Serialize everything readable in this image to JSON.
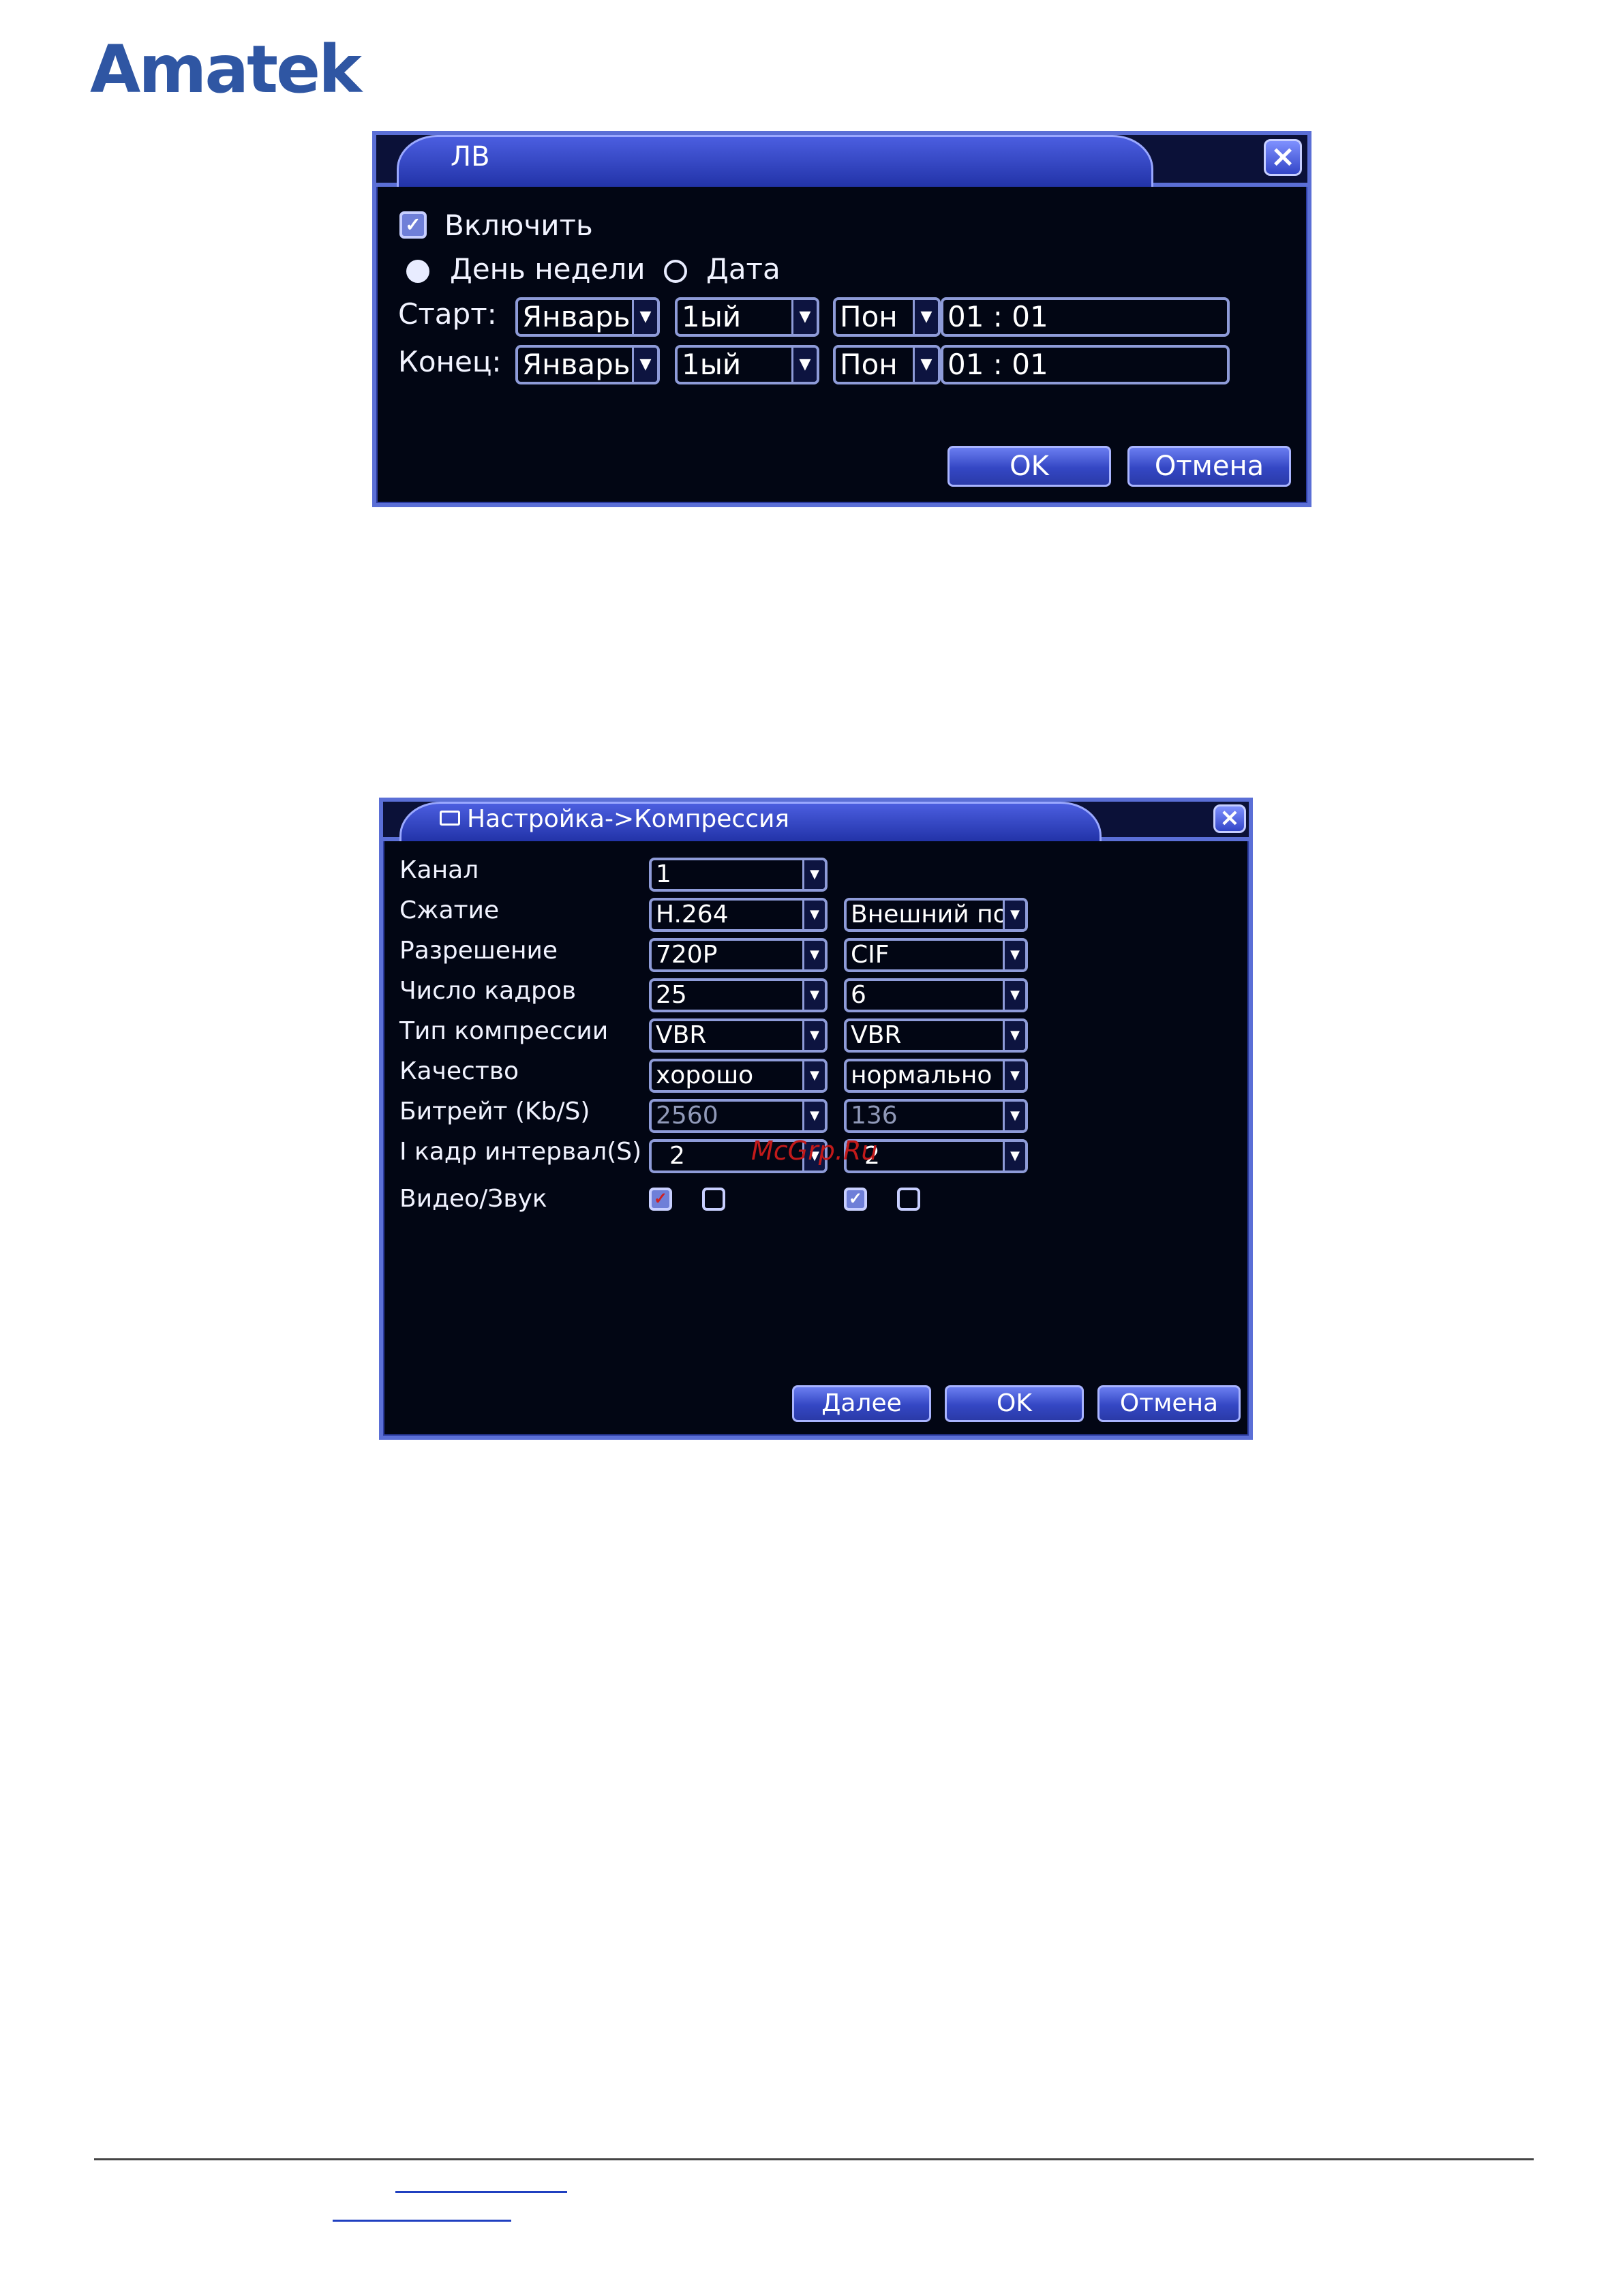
{
  "brand": "Amatek",
  "dialog1": {
    "title": "ЛВ",
    "close_glyph": "×",
    "enable_label": "Включить",
    "enable_checked": true,
    "radio_weekday_label": "День недели",
    "radio_date_label": "Дата",
    "radio_selected": "weekday",
    "start_label": "Старт:",
    "end_label": "Конец:",
    "start": {
      "month": "Январь",
      "week": "1ый",
      "day": "Пон",
      "time": "01 : 01"
    },
    "end": {
      "month": "Январь",
      "week": "1ый",
      "day": "Пон",
      "time": "01 : 01"
    },
    "ok_label": "OK",
    "cancel_label": "Отмена"
  },
  "dialog2": {
    "title": "Настройка->Компрессия",
    "close_glyph": "×",
    "rows": [
      {
        "label": "Канал",
        "main": "1"
      },
      {
        "label": "Сжатие",
        "main": "H.264",
        "extra": "Внешний по"
      },
      {
        "label": "Разрешение",
        "main": "720P",
        "extra": "CIF"
      },
      {
        "label": "Число кадров",
        "main": "25",
        "extra": "6"
      },
      {
        "label": "Тип компрессии",
        "main": "VBR",
        "extra": "VBR"
      },
      {
        "label": "Качество",
        "main": "хорошо",
        "extra": "нормально"
      },
      {
        "label": "Битрейт (Kb/S)",
        "main": "2560",
        "extra": "136"
      },
      {
        "label": "I кадр интервал(S)",
        "main": "2",
        "extra": "2"
      }
    ],
    "av_label": "Видео/Звук",
    "av_main": {
      "video": true,
      "audio": false
    },
    "av_extra": {
      "video": true,
      "audio": false
    },
    "next_label": "Далее",
    "ok_label": "OK",
    "cancel_label": "Отмена",
    "watermark": "McGrp.Ru"
  },
  "colors": {
    "brand": "#2f56a3",
    "dialog_bg": "#020614",
    "frame": "#5b6fd6"
  }
}
